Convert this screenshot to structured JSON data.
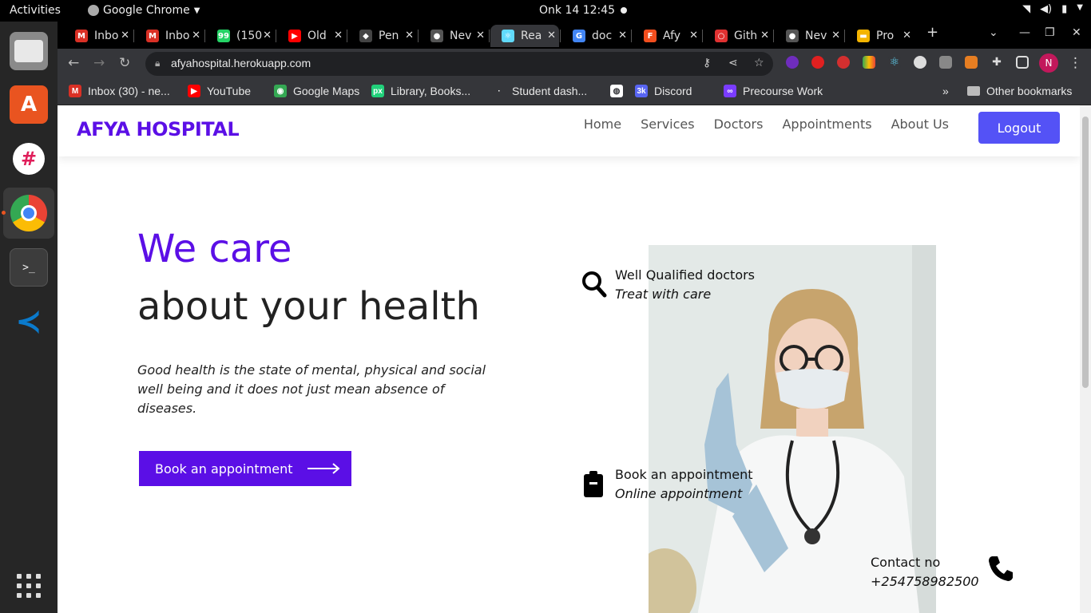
{
  "system": {
    "activities": "Activities",
    "app_name": "Google Chrome",
    "clock": "Onk 14  12:45"
  },
  "tabs": [
    {
      "label": "Inbo",
      "color": "#d93025",
      "glyph": "M"
    },
    {
      "label": "Inbo",
      "color": "#d93025",
      "glyph": "M"
    },
    {
      "label": "(150",
      "color": "#25d366",
      "glyph": "99"
    },
    {
      "label": "Old",
      "color": "#ff0000",
      "glyph": "▶"
    },
    {
      "label": "Pen",
      "color": "#444444",
      "glyph": "◆"
    },
    {
      "label": "Nev",
      "color": "#555555",
      "glyph": "●"
    },
    {
      "label": "Rea",
      "color": "#61dafb",
      "glyph": "⚛"
    },
    {
      "label": "doc",
      "color": "#4285f4",
      "glyph": "G"
    },
    {
      "label": "Afy",
      "color": "#f24e1e",
      "glyph": "F"
    },
    {
      "label": "Gith",
      "color": "#e03131",
      "glyph": "○"
    },
    {
      "label": "Nev",
      "color": "#555555",
      "glyph": "●"
    },
    {
      "label": "Pro",
      "color": "#f4b400",
      "glyph": "▬"
    }
  ],
  "address_bar": {
    "url": "afyahospital.herokuapp.com"
  },
  "bookmarks": [
    {
      "label": "Inbox (30) - ne...",
      "color": "#d93025",
      "glyph": "M"
    },
    {
      "label": "YouTube",
      "color": "#ff0000",
      "glyph": "▶"
    },
    {
      "label": "Google Maps",
      "color": "#34a853",
      "glyph": "◉"
    },
    {
      "label": "Library, Books...",
      "color": "#21d07a",
      "glyph": "px"
    },
    {
      "label": "Student dash...",
      "color": "#35363a",
      "glyph": "·"
    },
    {
      "label": "",
      "color": "#ffffff",
      "glyph": "◍"
    },
    {
      "label": "Discord",
      "color": "#5865f2",
      "glyph": "3k"
    },
    {
      "label": "Precourse Work",
      "color": "#7a3cff",
      "glyph": "∞"
    }
  ],
  "other_bookmarks": "Other bookmarks",
  "profile_initial": "N",
  "page": {
    "brand": "AFYA HOSPITAL",
    "nav": [
      "Home",
      "Services",
      "Doctors",
      "Appointments",
      "About Us"
    ],
    "logout": "Logout",
    "hero_line1": "We care",
    "hero_line2": "about your health",
    "hero_desc": "Good health is the state of mental, physical and social well being and it does not just mean absence of diseases.",
    "cta": "Book an appointment",
    "features": [
      {
        "title": "Well Qualified doctors",
        "subtitle": "Treat with care",
        "icon": "search-icon"
      },
      {
        "title": "Book an appointment",
        "subtitle": "Online appointment",
        "icon": "clipboard-icon"
      },
      {
        "title": "Contact no",
        "subtitle": "+254758982500",
        "icon": "phone-icon"
      }
    ]
  },
  "colors": {
    "brand": "#5b0fe6",
    "logout_button": "#5452f6"
  }
}
